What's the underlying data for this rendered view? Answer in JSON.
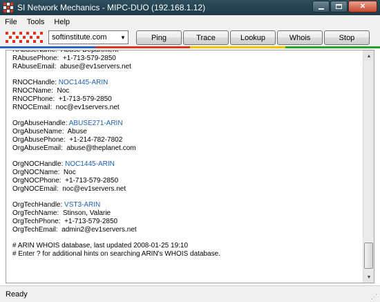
{
  "window": {
    "title": "SI Network Mechanics - MIPC-DUO (192.168.1.12)"
  },
  "menu": [
    "File",
    "Tools",
    "Help"
  ],
  "toolbar": {
    "host_value": "softinstitute.com",
    "buttons": [
      "Ping",
      "Trace",
      "Lookup",
      "Whois",
      "Stop"
    ]
  },
  "output": {
    "lines": [
      {
        "label": "RAbuseName:",
        "value": "Abuse Department"
      },
      {
        "label": "RAbusePhone:",
        "value": "+1-713-579-2850"
      },
      {
        "label": "RAbuseEmail:",
        "value": "abuse@ev1servers.net"
      },
      {
        "label": "",
        "value": ""
      },
      {
        "label": "RNOCHandle:",
        "value": "NOC1445-ARIN",
        "link": true
      },
      {
        "label": "RNOCName:",
        "value": "Noc"
      },
      {
        "label": "RNOCPhone:",
        "value": "+1-713-579-2850"
      },
      {
        "label": "RNOCEmail:",
        "value": "noc@ev1servers.net"
      },
      {
        "label": "",
        "value": ""
      },
      {
        "label": "OrgAbuseHandle:",
        "value": "ABUSE271-ARIN",
        "link": true
      },
      {
        "label": "OrgAbuseName:",
        "value": "Abuse"
      },
      {
        "label": "OrgAbusePhone:",
        "value": "+1-214-782-7802"
      },
      {
        "label": "OrgAbuseEmail:",
        "value": "abuse@theplanet.com"
      },
      {
        "label": "",
        "value": ""
      },
      {
        "label": "OrgNOCHandle:",
        "value": "NOC1445-ARIN",
        "link": true
      },
      {
        "label": "OrgNOCName:",
        "value": "Noc"
      },
      {
        "label": "OrgNOCPhone:",
        "value": "+1-713-579-2850"
      },
      {
        "label": "OrgNOCEmail:",
        "value": "noc@ev1servers.net"
      },
      {
        "label": "",
        "value": ""
      },
      {
        "label": "OrgTechHandle:",
        "value": "VST3-ARIN",
        "link": true
      },
      {
        "label": "OrgTechName:",
        "value": "Stinson, Valarie"
      },
      {
        "label": "OrgTechPhone:",
        "value": "+1-713-579-2850"
      },
      {
        "label": "OrgTechEmail:",
        "value": "admin2@ev1servers.net"
      },
      {
        "label": "",
        "value": ""
      },
      {
        "label": "# ARIN WHOIS database, last updated 2008-01-25 19:10",
        "value": ""
      },
      {
        "label": "# Enter ? for additional hints on searching ARIN's WHOIS database.",
        "value": ""
      }
    ]
  },
  "status": {
    "text": "Ready"
  },
  "colors": {
    "link": "#1b5fb5",
    "logo_red": "#e0301e",
    "strip": [
      "#2a62c9",
      "#e0301e",
      "#f2c200",
      "#2aa12a"
    ]
  }
}
